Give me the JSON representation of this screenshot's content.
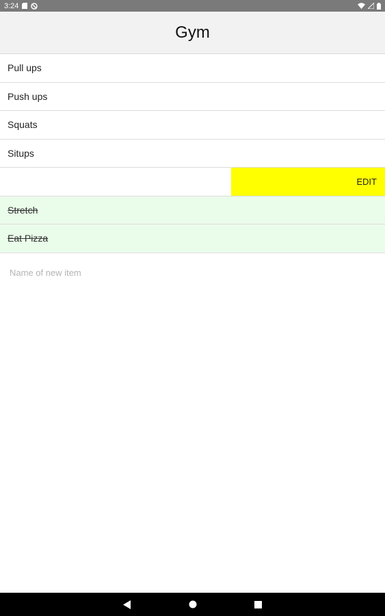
{
  "status_bar": {
    "time": "3:24",
    "icons": [
      "sd-card-icon",
      "no-sync-icon",
      "wifi-icon",
      "signal-icon",
      "battery-icon"
    ]
  },
  "header": {
    "title": "Gym"
  },
  "list": {
    "items": [
      {
        "label": "Pull ups",
        "done": false
      },
      {
        "label": "Push ups",
        "done": false
      },
      {
        "label": "Squats",
        "done": false
      },
      {
        "label": "Situps",
        "done": false
      },
      {
        "label": "",
        "done": false,
        "action": "EDIT"
      },
      {
        "label": "Stretch",
        "done": true
      },
      {
        "label": "Eat Pizza",
        "done": true
      }
    ]
  },
  "new_item": {
    "placeholder": "Name of new item",
    "value": ""
  },
  "colors": {
    "edit_action": "#ffff00",
    "done_row": "#eafcea",
    "header_bg": "#f2f2f3"
  },
  "nav_bar": {
    "icons": [
      "back-icon",
      "home-icon",
      "recents-icon"
    ]
  }
}
